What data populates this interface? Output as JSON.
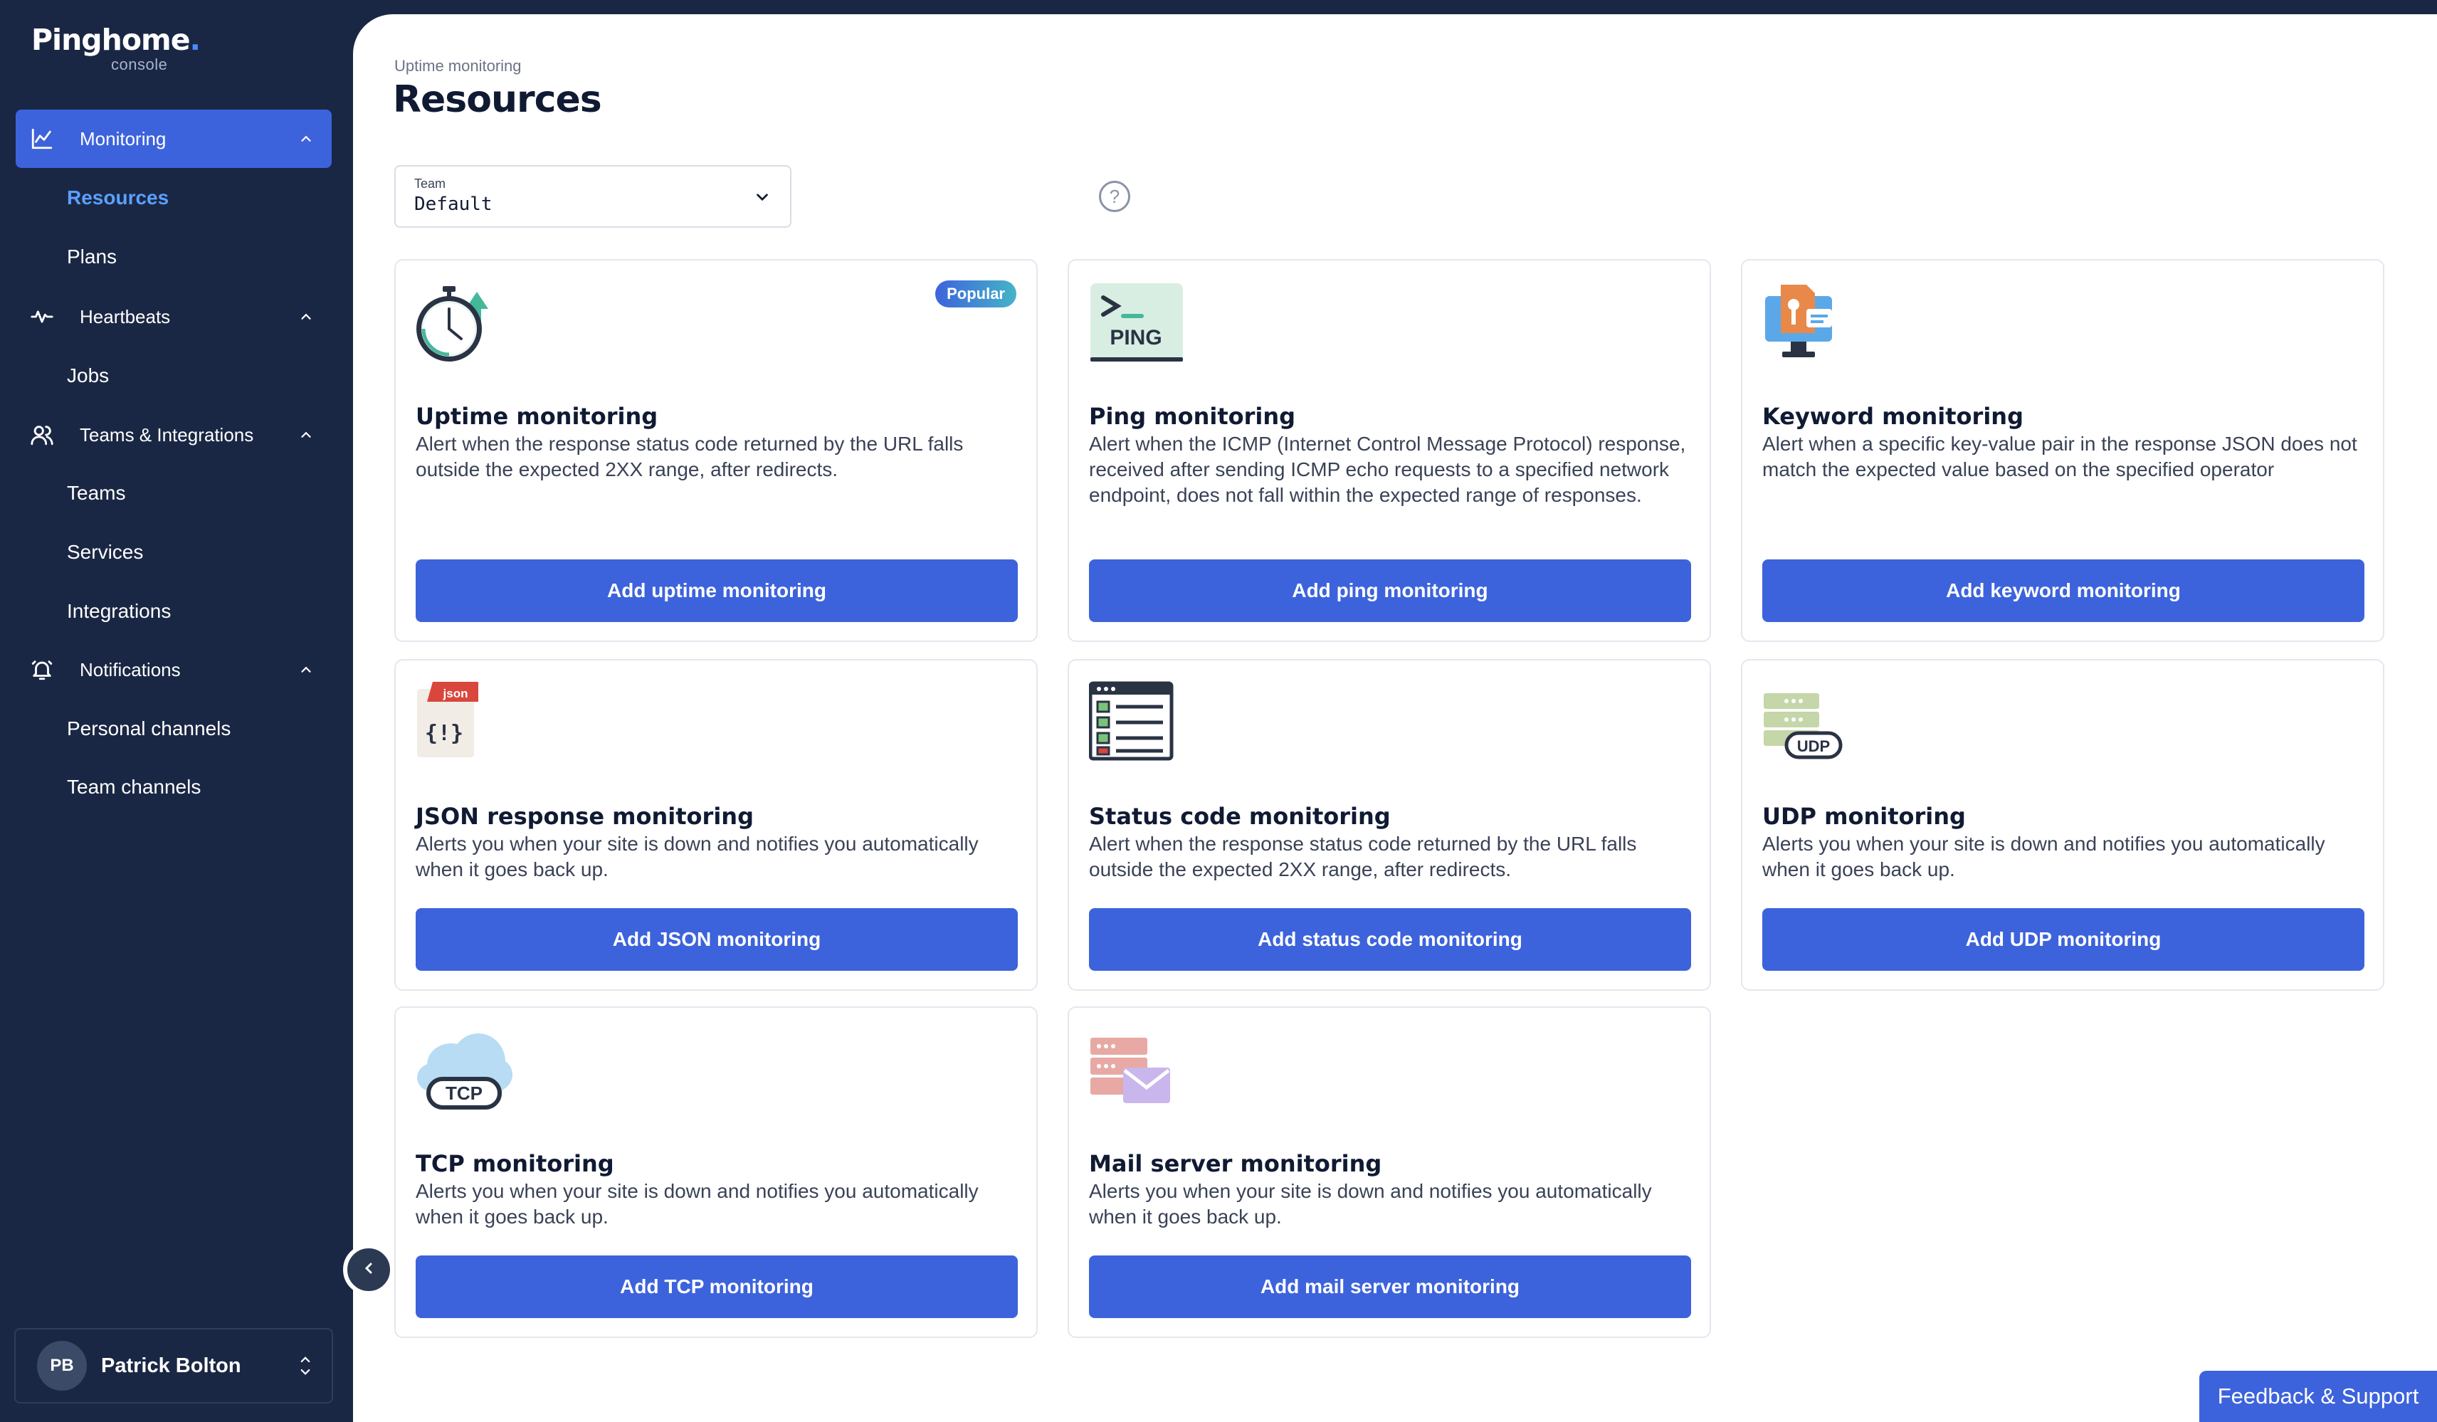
{
  "brand": {
    "name": "Pinghome",
    "dot": ".",
    "sub": "console"
  },
  "sidebar": {
    "sections": [
      {
        "label": "Monitoring",
        "items": [
          "Resources",
          "Plans"
        ]
      },
      {
        "label": "Heartbeats",
        "items": [
          "Jobs"
        ]
      },
      {
        "label": "Teams & Integrations",
        "items": [
          "Teams",
          "Services",
          "Integrations"
        ]
      },
      {
        "label": "Notifications",
        "items": [
          "Personal channels",
          "Team channels"
        ]
      }
    ],
    "active_item": "Resources"
  },
  "user": {
    "initials": "PB",
    "name": "Patrick Bolton"
  },
  "header": {
    "breadcrumb": "Uptime monitoring",
    "title": "Resources"
  },
  "team_select": {
    "label": "Team",
    "value": "Default",
    "help": "?"
  },
  "cards": [
    {
      "title": "Uptime monitoring",
      "desc": "Alert when the response status code returned by the URL falls outside the expected 2XX range, after redirects.",
      "button": "Add uptime monitoring",
      "badge": "Popular",
      "icon": "stopwatch-icon"
    },
    {
      "title": "Ping monitoring",
      "desc": "Alert when the ICMP (Internet Control Message Protocol) response, received after sending ICMP echo requests to a specified network endpoint, does not fall within the expected range of responses.",
      "button": "Add ping monitoring",
      "icon": "ping-terminal-icon",
      "icon_text": "PING"
    },
    {
      "title": "Keyword monitoring",
      "desc": "Alert when a specific key-value pair in the response JSON does not match the expected value based on the specified operator",
      "button": "Add keyword monitoring",
      "icon": "keyword-monitor-icon"
    },
    {
      "title": "JSON response monitoring",
      "desc": "Alerts you when your site is down and notifies you automatically when it goes back up.",
      "button": "Add JSON monitoring",
      "icon": "json-file-icon",
      "icon_text": "json",
      "icon_text2": "{!}"
    },
    {
      "title": "Status code monitoring",
      "desc": "Alert when the response status code returned by the URL falls outside the expected 2XX range, after redirects.",
      "button": "Add status code monitoring",
      "icon": "status-checklist-icon"
    },
    {
      "title": "UDP monitoring",
      "desc": "Alerts you when your site is down and notifies you automatically when it goes back up.",
      "button": "Add UDP monitoring",
      "icon": "udp-server-icon",
      "icon_text": "UDP"
    },
    {
      "title": "TCP monitoring",
      "desc": "Alerts you when your site is down and notifies you automatically when it goes back up.",
      "button": "Add TCP monitoring",
      "icon": "tcp-cloud-icon",
      "icon_text": "TCP"
    },
    {
      "title": "Mail server monitoring",
      "desc": "Alerts you when your site is down and notifies you automatically when it goes back up.",
      "button": "Add mail server monitoring",
      "icon": "mail-server-icon"
    }
  ],
  "feedback": {
    "label": "Feedback & Support"
  }
}
